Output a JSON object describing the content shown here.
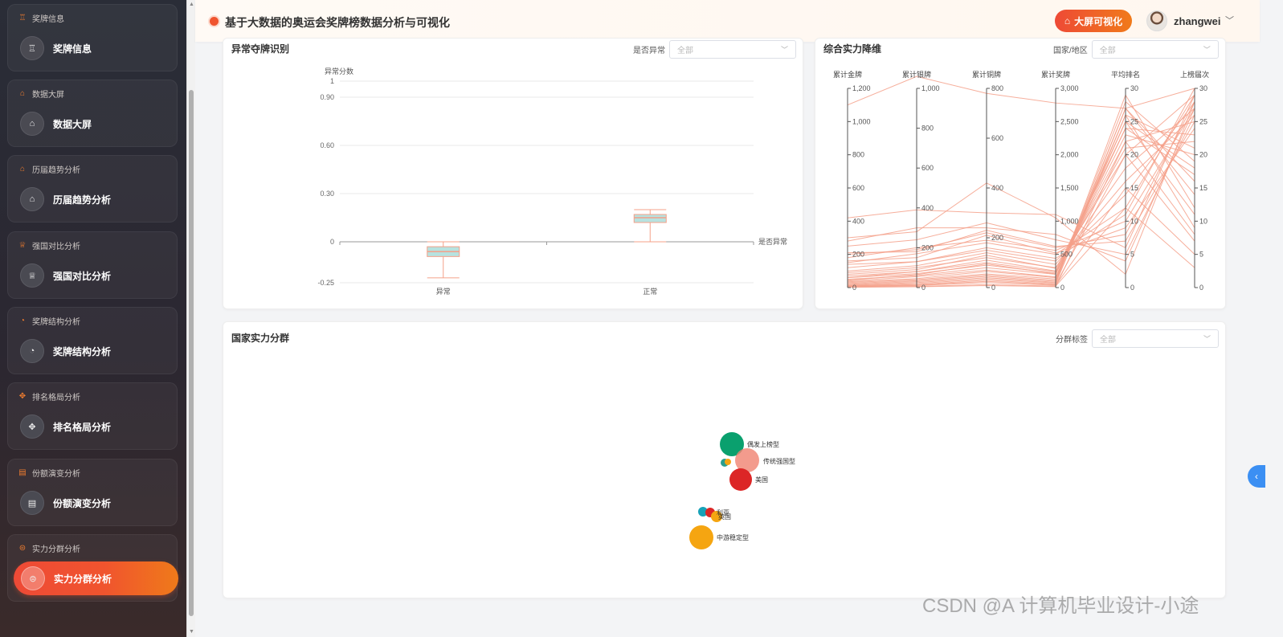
{
  "sidebar": {
    "groups": [
      {
        "header": "奖牌信息",
        "label": "奖牌信息",
        "icon": "medal-icon",
        "glyph": "♖",
        "active": false
      },
      {
        "header": "数据大屏",
        "label": "数据大屏",
        "icon": "screen-icon",
        "glyph": "⌂",
        "active": false
      },
      {
        "header": "历届趋势分析",
        "label": "历届趋势分析",
        "icon": "trend-icon",
        "glyph": "⌂",
        "active": false
      },
      {
        "header": "强国对比分析",
        "label": "强国对比分析",
        "icon": "trophy-icon",
        "glyph": "♕",
        "active": false
      },
      {
        "header": "奖牌结构分析",
        "label": "奖牌结构分析",
        "icon": "pie-icon",
        "glyph": "◔",
        "active": false
      },
      {
        "header": "排名格局分析",
        "label": "排名格局分析",
        "icon": "move-icon",
        "glyph": "✥",
        "active": false
      },
      {
        "header": "份额演变分析",
        "label": "份额演变分析",
        "icon": "share-icon",
        "glyph": "▤",
        "active": false
      },
      {
        "header": "实力分群分析",
        "label": "实力分群分析",
        "icon": "cluster-icon",
        "glyph": "⊜",
        "active": true
      }
    ]
  },
  "header": {
    "title": "基于大数据的奥运会奖牌榜数据分析与可视化",
    "screen_button": "大屏可视化",
    "username": "zhangwei"
  },
  "cards": {
    "anomaly": {
      "title": "异常夺牌识别",
      "filter_label": "是否异常",
      "filter_value": "全部"
    },
    "parallel": {
      "title": "综合实力降维",
      "filter_label": "国家/地区",
      "filter_value": "全部"
    },
    "cluster": {
      "title": "国家实力分群",
      "filter_label": "分群标签",
      "filter_value": "全部"
    }
  },
  "watermark": "CSDN @A 计算机毕业设计-小途",
  "colors": {
    "accent": "#f0542e",
    "accent2": "#f07a1a",
    "line": "#f4a089"
  },
  "chart_data": [
    {
      "type": "boxplot",
      "ylabel": "异常分数",
      "xlabel": "是否异常",
      "categories": [
        "异常",
        "正常"
      ],
      "yticks": [
        -0.25,
        0,
        0.3,
        0.6,
        0.9,
        1
      ],
      "ytick_labels": [
        "-0.25",
        "0",
        "0.30",
        "0.60",
        "0.90",
        "1"
      ],
      "ylim": [
        -0.25,
        1
      ],
      "boxes": [
        {
          "category": "异常",
          "min": -0.22,
          "q1": -0.09,
          "median": -0.06,
          "q3": -0.03,
          "max": 0.0
        },
        {
          "category": "正常",
          "min": 0.0,
          "q1": 0.12,
          "median": 0.15,
          "q3": 0.17,
          "max": 0.2
        }
      ]
    },
    {
      "type": "parallel",
      "axes": [
        {
          "name": "累计金牌",
          "max": 1200,
          "ticks": [
            0,
            200,
            400,
            600,
            800,
            1000,
            1200
          ],
          "labels": [
            "0",
            "200",
            "400",
            "600",
            "800",
            "1,000",
            "1,200"
          ]
        },
        {
          "name": "累计银牌",
          "max": 1000,
          "ticks": [
            0,
            200,
            400,
            600,
            800,
            1000
          ],
          "labels": [
            "0",
            "200",
            "400",
            "600",
            "800",
            "1,000"
          ]
        },
        {
          "name": "累计铜牌",
          "max": 800,
          "ticks": [
            0,
            200,
            400,
            600,
            800
          ],
          "labels": [
            "0",
            "200",
            "400",
            "600",
            "800"
          ]
        },
        {
          "name": "累计奖牌",
          "max": 3000,
          "ticks": [
            0,
            500,
            1000,
            1500,
            2000,
            2500,
            3000
          ],
          "labels": [
            "0",
            "500",
            "1,000",
            "1,500",
            "2,000",
            "2,500",
            "3,000"
          ]
        },
        {
          "name": "平均排名",
          "max": 30,
          "ticks": [
            0,
            5,
            10,
            15,
            20,
            25,
            30
          ],
          "labels": [
            "0",
            "5",
            "10",
            "15",
            "20",
            "25",
            "30"
          ]
        },
        {
          "name": "上榜届次",
          "max": 30,
          "ticks": [
            0,
            5,
            10,
            15,
            20,
            25,
            30
          ],
          "labels": [
            "0",
            "5",
            "10",
            "15",
            "20",
            "25",
            "30"
          ]
        }
      ],
      "lines": [
        [
          1100,
          1060,
          780,
          2780,
          27,
          30
        ],
        [
          300,
          280,
          420,
          1050,
          2,
          28
        ],
        [
          420,
          390,
          300,
          1100,
          6,
          29
        ],
        [
          280,
          300,
          240,
          800,
          4,
          27
        ],
        [
          200,
          190,
          220,
          600,
          8,
          28
        ],
        [
          250,
          240,
          260,
          720,
          5,
          26
        ],
        [
          180,
          200,
          190,
          560,
          10,
          27
        ],
        [
          150,
          170,
          180,
          500,
          12,
          29
        ],
        [
          210,
          180,
          230,
          620,
          7,
          25
        ],
        [
          160,
          150,
          210,
          520,
          9,
          24
        ],
        [
          120,
          130,
          150,
          400,
          14,
          28
        ],
        [
          100,
          110,
          140,
          350,
          16,
          26
        ],
        [
          90,
          100,
          120,
          300,
          18,
          27
        ],
        [
          80,
          90,
          130,
          290,
          20,
          29
        ],
        [
          70,
          80,
          100,
          240,
          21,
          22
        ],
        [
          60,
          70,
          90,
          220,
          22,
          25
        ],
        [
          50,
          60,
          80,
          200,
          23,
          20
        ],
        [
          40,
          55,
          70,
          160,
          24,
          23
        ],
        [
          35,
          45,
          65,
          150,
          25,
          18
        ],
        [
          30,
          40,
          55,
          130,
          26,
          21
        ],
        [
          25,
          35,
          50,
          110,
          27,
          16
        ],
        [
          20,
          30,
          45,
          95,
          28,
          19
        ],
        [
          15,
          25,
          40,
          80,
          29,
          12
        ],
        [
          12,
          20,
          35,
          70,
          27,
          14
        ],
        [
          10,
          15,
          30,
          55,
          26,
          9
        ],
        [
          8,
          12,
          25,
          45,
          20,
          7
        ],
        [
          5,
          10,
          20,
          35,
          15,
          5
        ],
        [
          3,
          6,
          12,
          22,
          12,
          3
        ],
        [
          2,
          4,
          8,
          14,
          22,
          8
        ],
        [
          140,
          130,
          160,
          440,
          11,
          30
        ],
        [
          60,
          80,
          110,
          250,
          24,
          17
        ],
        [
          45,
          65,
          95,
          205,
          25,
          11
        ]
      ]
    },
    {
      "type": "scatter",
      "points": [
        {
          "label": "偶发上榜型",
          "color": "#0aa06e",
          "r": 15
        },
        {
          "label": "传统强国型",
          "color": "#f08270",
          "r": 15
        },
        {
          "label": "美国",
          "color": "#dc2626",
          "r": 14
        },
        {
          "label": "中游稳定型",
          "color": "#f5a511",
          "r": 15
        },
        {
          "label": "",
          "color": "#17a2b8",
          "r": 6
        },
        {
          "label": "",
          "color": "#dc2626",
          "r": 6
        },
        {
          "label": "",
          "color": "#f5a511",
          "r": 7
        },
        {
          "label": "",
          "color": "#2b9e8e",
          "r": 5
        },
        {
          "label": "",
          "color": "#f5a511",
          "r": 4
        }
      ],
      "annotations": [
        "利亚",
        "英国"
      ]
    }
  ]
}
